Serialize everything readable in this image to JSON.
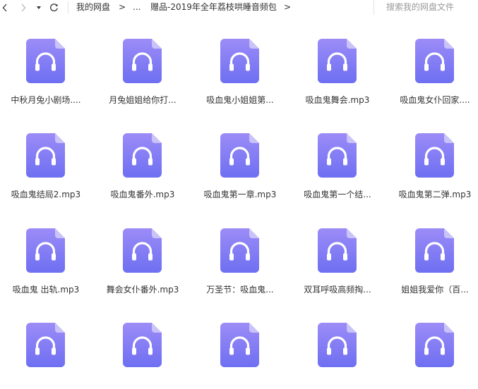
{
  "toolbar": {
    "breadcrumb": [
      {
        "label": "我的网盘"
      },
      {
        "label": "..."
      },
      {
        "label": "赠品-2019年全年荔枝哄睡音频包"
      }
    ],
    "separator": ">",
    "search_placeholder": "搜索我的网盘文件"
  },
  "icons": {
    "back": "chevron-left-icon",
    "forward": "chevron-right-icon",
    "history": "caret-down-icon",
    "refresh": "refresh-icon",
    "file": "audio-file-icon"
  },
  "colors": {
    "file_icon_gradient_start": "#9c8cf7",
    "file_icon_gradient_end": "#6e6ff2",
    "file_icon_fold": "#c9c3fa"
  },
  "files": [
    {
      "name": "中秋月兔小剧场...."
    },
    {
      "name": "月兔姐姐给你打..."
    },
    {
      "name": "吸血鬼小姐姐第..."
    },
    {
      "name": "吸血鬼舞会.mp3"
    },
    {
      "name": "吸血鬼女仆回家...."
    },
    {
      "name": "吸血鬼结局2.mp3"
    },
    {
      "name": "吸血鬼番外.mp3"
    },
    {
      "name": "吸血鬼第一章.mp3"
    },
    {
      "name": "吸血鬼第一个结..."
    },
    {
      "name": "吸血鬼第二弹.mp3"
    },
    {
      "name": "吸血鬼 出轨.mp3"
    },
    {
      "name": "舞会女仆番外.mp3"
    },
    {
      "name": "万圣节：吸血鬼..."
    },
    {
      "name": "双耳呼吸高频掏..."
    },
    {
      "name": "姐姐我爱你（百..."
    },
    {
      "name": ""
    },
    {
      "name": ""
    },
    {
      "name": ""
    },
    {
      "name": ""
    },
    {
      "name": ""
    }
  ]
}
